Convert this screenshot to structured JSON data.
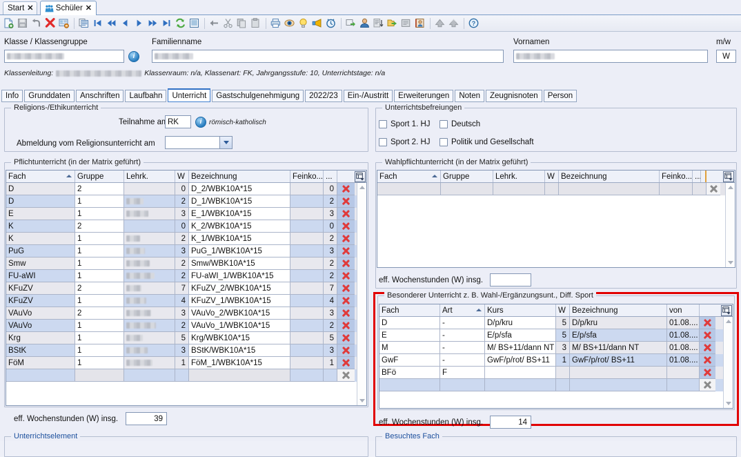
{
  "window": {
    "tabs": [
      {
        "label": "Start",
        "icon": "none",
        "active": false,
        "close": "✕"
      },
      {
        "label": "Schüler",
        "icon": "students-icon",
        "active": true,
        "close": "✕"
      }
    ]
  },
  "toolbar": {
    "icons": [
      "new-document-icon",
      "save-icon",
      "undo-icon",
      "delete-icon",
      "form-edit-icon",
      "sep",
      "copy-record-icon",
      "first-record-icon",
      "prev-page-icon",
      "prev-record-icon",
      "next-record-icon",
      "next-page-icon",
      "last-record-icon",
      "refresh-icon",
      "list-view-icon",
      "sep",
      "back-arrow-icon",
      "cut-icon",
      "copy-icon",
      "paste-icon",
      "sep",
      "print-icon",
      "preview-icon",
      "hint-icon",
      "announce-icon",
      "reminder-icon",
      "sep",
      "export-icon",
      "user-icon",
      "sort-az-icon",
      "open-folder-icon",
      "note-icon",
      "id-card-icon",
      "sep",
      "up-arrow-icon",
      "up-double-arrow-icon",
      "sep",
      "help-icon"
    ]
  },
  "header": {
    "klasse_label": "Klasse / Klassengruppe",
    "klasse_value": "",
    "info_button": "i",
    "familienname_label": "Familienname",
    "familienname_value": "",
    "vornamen_label": "Vornamen",
    "vornamen_value": "",
    "mw_label": "m/w",
    "mw_value": "W",
    "status_prefix": "Klassenleitung:",
    "status_rest": "Klassenraum: n/a, Klassenart: FK, Jahrgangsstufe: 10, Unterrichtstage: n/a"
  },
  "page_tabs": [
    {
      "label": "Info",
      "selected": false
    },
    {
      "label": "Grunddaten",
      "selected": false
    },
    {
      "label": "Anschriften",
      "selected": false
    },
    {
      "label": "Laufbahn",
      "selected": false
    },
    {
      "label": "Unterricht",
      "selected": true
    },
    {
      "label": "Gastschulgenehmigung",
      "selected": false
    },
    {
      "label": "2022/23",
      "selected": false
    },
    {
      "label": "Ein-/Austritt",
      "selected": false
    },
    {
      "label": "Erweiterungen",
      "selected": false
    },
    {
      "label": "Noten",
      "selected": false
    },
    {
      "label": "Zeugnisnoten",
      "selected": false
    },
    {
      "label": "Person",
      "selected": false
    }
  ],
  "religion": {
    "group_title": "Religions-/Ethikunterricht",
    "teilnahme_label": "Teilnahme am RU",
    "teilnahme_value": "RK",
    "teilnahme_hint": "römisch-katholisch",
    "abmeldung_label": "Abmeldung vom Religionsunterricht am",
    "abmeldung_value": ""
  },
  "pflicht": {
    "group_title": "Pflichtunterricht (in der Matrix geführt)",
    "columns": [
      "Fach",
      "Gruppe",
      "Lehrk.",
      "W",
      "Bezeichnung",
      "Feinko...",
      "..."
    ],
    "sort_column": "Fach",
    "rows": [
      {
        "fach": "D",
        "gruppe": "2",
        "lehrk": "",
        "w": "0",
        "bez": "D_2/WBK10A*15",
        "feinko": "",
        "n": "0"
      },
      {
        "fach": "D",
        "gruppe": "1",
        "lehrk": "",
        "w": "2",
        "bez": "D_1/WBK10A*15",
        "feinko": "",
        "n": "2"
      },
      {
        "fach": "E",
        "gruppe": "1",
        "lehrk": "",
        "w": "3",
        "bez": "E_1/WBK10A*15",
        "feinko": "",
        "n": "3"
      },
      {
        "fach": "K",
        "gruppe": "2",
        "lehrk": "",
        "w": "0",
        "bez": "K_2/WBK10A*15",
        "feinko": "",
        "n": "0"
      },
      {
        "fach": "K",
        "gruppe": "1",
        "lehrk": "",
        "w": "2",
        "bez": "K_1/WBK10A*15",
        "feinko": "",
        "n": "2"
      },
      {
        "fach": "PuG",
        "gruppe": "1",
        "lehrk": "",
        "w": "3",
        "bez": "PuG_1/WBK10A*15",
        "feinko": "",
        "n": "3"
      },
      {
        "fach": "Smw",
        "gruppe": "1",
        "lehrk": "",
        "w": "2",
        "bez": "Smw/WBK10A*15",
        "feinko": "",
        "n": "2"
      },
      {
        "fach": "FU-aWI",
        "gruppe": "1",
        "lehrk": "",
        "w": "2",
        "bez": "FU-aWI_1/WBK10A*15",
        "feinko": "",
        "n": "2"
      },
      {
        "fach": "KFuZV",
        "gruppe": "2",
        "lehrk": "",
        "w": "7",
        "bez": "KFuZV_2/WBK10A*15",
        "feinko": "",
        "n": "7"
      },
      {
        "fach": "KFuZV",
        "gruppe": "1",
        "lehrk": "",
        "w": "4",
        "bez": "KFuZV_1/WBK10A*15",
        "feinko": "",
        "n": "4"
      },
      {
        "fach": "VAuVo",
        "gruppe": "2",
        "lehrk": "",
        "w": "3",
        "bez": "VAuVo_2/WBK10A*15",
        "feinko": "",
        "n": "3"
      },
      {
        "fach": "VAuVo",
        "gruppe": "1",
        "lehrk": "",
        "w": "2",
        "bez": "VAuVo_1/WBK10A*15",
        "feinko": "",
        "n": "2"
      },
      {
        "fach": "Krg",
        "gruppe": "1",
        "lehrk": "",
        "w": "5",
        "bez": "Krg/WBK10A*15",
        "feinko": "",
        "n": "5"
      },
      {
        "fach": "BStK",
        "gruppe": "1",
        "lehrk": "",
        "w": "3",
        "bez": "BStK/WBK10A*15",
        "feinko": "",
        "n": "3"
      },
      {
        "fach": "FöM",
        "gruppe": "1",
        "lehrk": "",
        "w": "1",
        "bez": "FöM_1/WBK10A*15",
        "feinko": "",
        "n": "1"
      }
    ],
    "total_label": "eff. Wochenstunden (W) insg.",
    "total_value": "39"
  },
  "befreiungen": {
    "group_title": "Unterrichtsbefreiungen",
    "items": [
      {
        "label": "Sport 1. HJ",
        "checked": false
      },
      {
        "label": "Deutsch",
        "checked": false
      },
      {
        "label": "Sport 2. HJ",
        "checked": false
      },
      {
        "label": "Politik und Gesellschaft",
        "checked": false
      }
    ]
  },
  "wahlpflicht": {
    "group_title": "Wahlpflichtunterricht (in der Matrix geführt)",
    "columns": [
      "Fach",
      "Gruppe",
      "Lehrk.",
      "W",
      "Bezeichnung",
      "Feinko...",
      "..."
    ],
    "sort_column": "Fach",
    "rows": [],
    "total_label": "eff. Wochenstunden (W) insg.",
    "total_value": ""
  },
  "besonderer": {
    "group_title": "Besonderer Unterricht z. B. Wahl-/Ergänzungsunt., Diff. Sport",
    "highlight_color": "#e10000",
    "columns": [
      "Fach",
      "Art",
      "Kurs",
      "W",
      "Bezeichnung",
      "von"
    ],
    "sort_column": "Art",
    "rows": [
      {
        "fach": "D",
        "art": "-",
        "kurs": "D/p/kru",
        "w": "5",
        "bez": "D/p/kru",
        "von": "01.08...."
      },
      {
        "fach": "E",
        "art": "-",
        "kurs": "E/p/sfa",
        "w": "5",
        "bez": "E/p/sfa",
        "von": "01.08...."
      },
      {
        "fach": "M",
        "art": "-",
        "kurs": "M/ BS+11/dann NT",
        "w": "3",
        "bez": "M/ BS+11/dann NT",
        "von": "01.08...."
      },
      {
        "fach": "GwF",
        "art": "-",
        "kurs": "GwF/p/rot/ BS+11",
        "w": "1",
        "bez": "GwF/p/rot/ BS+11",
        "von": "01.08...."
      },
      {
        "fach": "BFö",
        "art": "F",
        "kurs": "",
        "w": "",
        "bez": "",
        "von": ""
      }
    ],
    "total_label": "eff. Wochenstunden (W) insg.",
    "total_value": "14"
  },
  "bottom": {
    "left_group": "Unterrichtselement",
    "right_group": "Besuchtes Fach"
  }
}
